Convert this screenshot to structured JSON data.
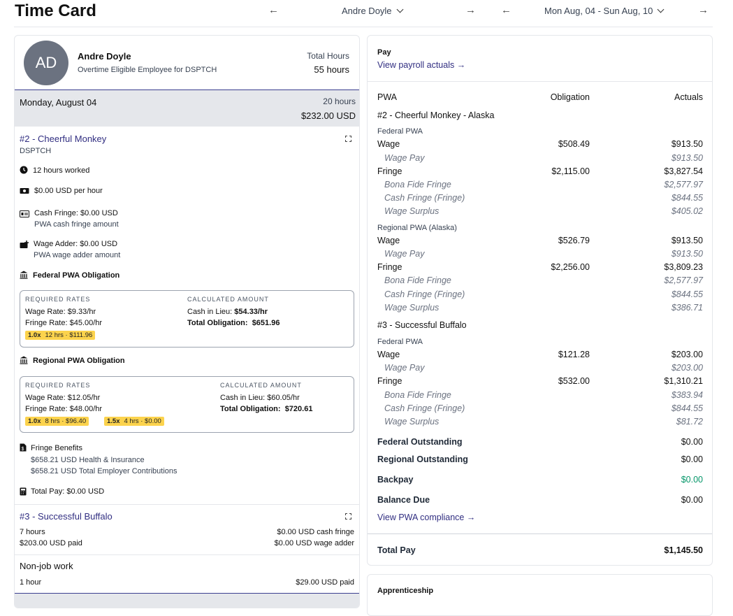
{
  "header": {
    "title": "Time Card",
    "employee_select": "Andre Doyle",
    "week_select": "Mon Aug, 04 - Sun Aug, 10"
  },
  "employee": {
    "initials": "AD",
    "name": "Andre Doyle",
    "subtitle": "Overtime Eligible Employee for DSPTCH",
    "total_hours_label": "Total Hours",
    "total_hours_value": "55 hours"
  },
  "day": {
    "name": "Monday, August 04",
    "hours": "20 hours",
    "amount": "$232.00 USD"
  },
  "job1": {
    "title": "#2 - Cheerful Monkey",
    "code": "DSPTCH",
    "hours_worked": "12 hours worked",
    "per_hour": "$0.00 USD per hour",
    "cash_fringe": "Cash Fringe: $0.00 USD",
    "cash_fringe_sub": "PWA cash fringe amount",
    "wage_adder": "Wage Adder: $0.00 USD",
    "wage_adder_sub": "PWA wage adder amount",
    "federal": {
      "heading": "Federal PWA Obligation",
      "req_label": "REQUIRED RATES",
      "calc_label": "CALCULATED AMOUNT",
      "wage_rate_label": "Wage Rate:",
      "wage_rate": "$9.33/hr",
      "fringe_rate_label": "Fringe Rate:",
      "fringe_rate": "$45.00/hr",
      "cash_label": "Cash in Lieu:",
      "cash": "$54.33/hr",
      "total_label": "Total Obligation:",
      "total": "$651.96",
      "badges": [
        {
          "mult": "1.0x",
          "text": "12 hrs · $111.96"
        }
      ]
    },
    "regional": {
      "heading": "Regional PWA Obligation",
      "req_label": "REQUIRED RATES",
      "calc_label": "CALCULATED AMOUNT",
      "wage_rate_label": "Wage Rate:",
      "wage_rate": "$12.05/hr",
      "fringe_rate_label": "Fringe Rate:",
      "fringe_rate": "$48.00/hr",
      "cash_label": "Cash in Lieu:",
      "cash": "$60.05/hr",
      "total_label": "Total Obligation:",
      "total": "$720.61",
      "badges": [
        {
          "mult": "1.0x",
          "text": "8 hrs · $96.40"
        },
        {
          "mult": "1.5x",
          "text": "4 hrs · $0.00"
        }
      ]
    },
    "fringe_heading": "Fringe Benefits",
    "fringe_lines": [
      "$658.21 USD Health & Insurance",
      "$658.21 USD Total Employer Contributions"
    ],
    "total_pay": "Total Pay: $0.00 USD"
  },
  "job2": {
    "title": "#3 - Successful Buffalo",
    "hours": "7 hours",
    "paid": "$203.00 USD paid",
    "cash_fringe": "$0.00 USD cash fringe",
    "wage_adder": "$0.00 USD wage adder"
  },
  "nonjob": {
    "title": "Non-job work",
    "hours": "1 hour",
    "paid": "$29.00 USD paid"
  },
  "pay": {
    "heading": "Pay",
    "link": "View payroll actuals",
    "col_pwa": "PWA",
    "col_obl": "Obligation",
    "col_act": "Actuals",
    "job1": "#2 - Cheerful Monkey - Alaska",
    "job2": "#3 - Successful Buffalo",
    "sections": [
      {
        "label": "Federal PWA",
        "wage_obl": "$508.49",
        "wage_act": "$913.50",
        "wage_pay": "$913.50",
        "fringe_obl": "$2,115.00",
        "fringe_act": "$3,827.54",
        "bona": "$2,577.97",
        "cash": "$844.55",
        "surplus": "$405.02"
      },
      {
        "label": "Regional PWA (Alaska)",
        "wage_obl": "$526.79",
        "wage_act": "$913.50",
        "wage_pay": "$913.50",
        "fringe_obl": "$2,256.00",
        "fringe_act": "$3,809.23",
        "bona": "$2,577.97",
        "cash": "$844.55",
        "surplus": "$386.71"
      },
      {
        "label": "Federal PWA",
        "wage_obl": "$121.28",
        "wage_act": "$203.00",
        "wage_pay": "$203.00",
        "fringe_obl": "$532.00",
        "fringe_act": "$1,310.21",
        "bona": "$383.94",
        "cash": "$844.55",
        "surplus": "$81.72"
      }
    ],
    "labels": {
      "wage": "Wage",
      "wage_pay": "Wage Pay",
      "fringe": "Fringe",
      "bona": "Bona Fide Fringe",
      "cash": "Cash Fringe (Fringe)",
      "surplus": "Wage Surplus"
    },
    "fed_out_label": "Federal Outstanding",
    "fed_out": "$0.00",
    "reg_out_label": "Regional Outstanding",
    "reg_out": "$0.00",
    "backpay_label": "Backpay",
    "backpay": "$0.00",
    "balance_label": "Balance Due",
    "balance": "$0.00",
    "compliance_link": "View PWA compliance",
    "total_label": "Total Pay",
    "total": "$1,145.50",
    "backpay_color": "#059669"
  },
  "apprenticeship": {
    "heading": "Apprenticeship"
  }
}
